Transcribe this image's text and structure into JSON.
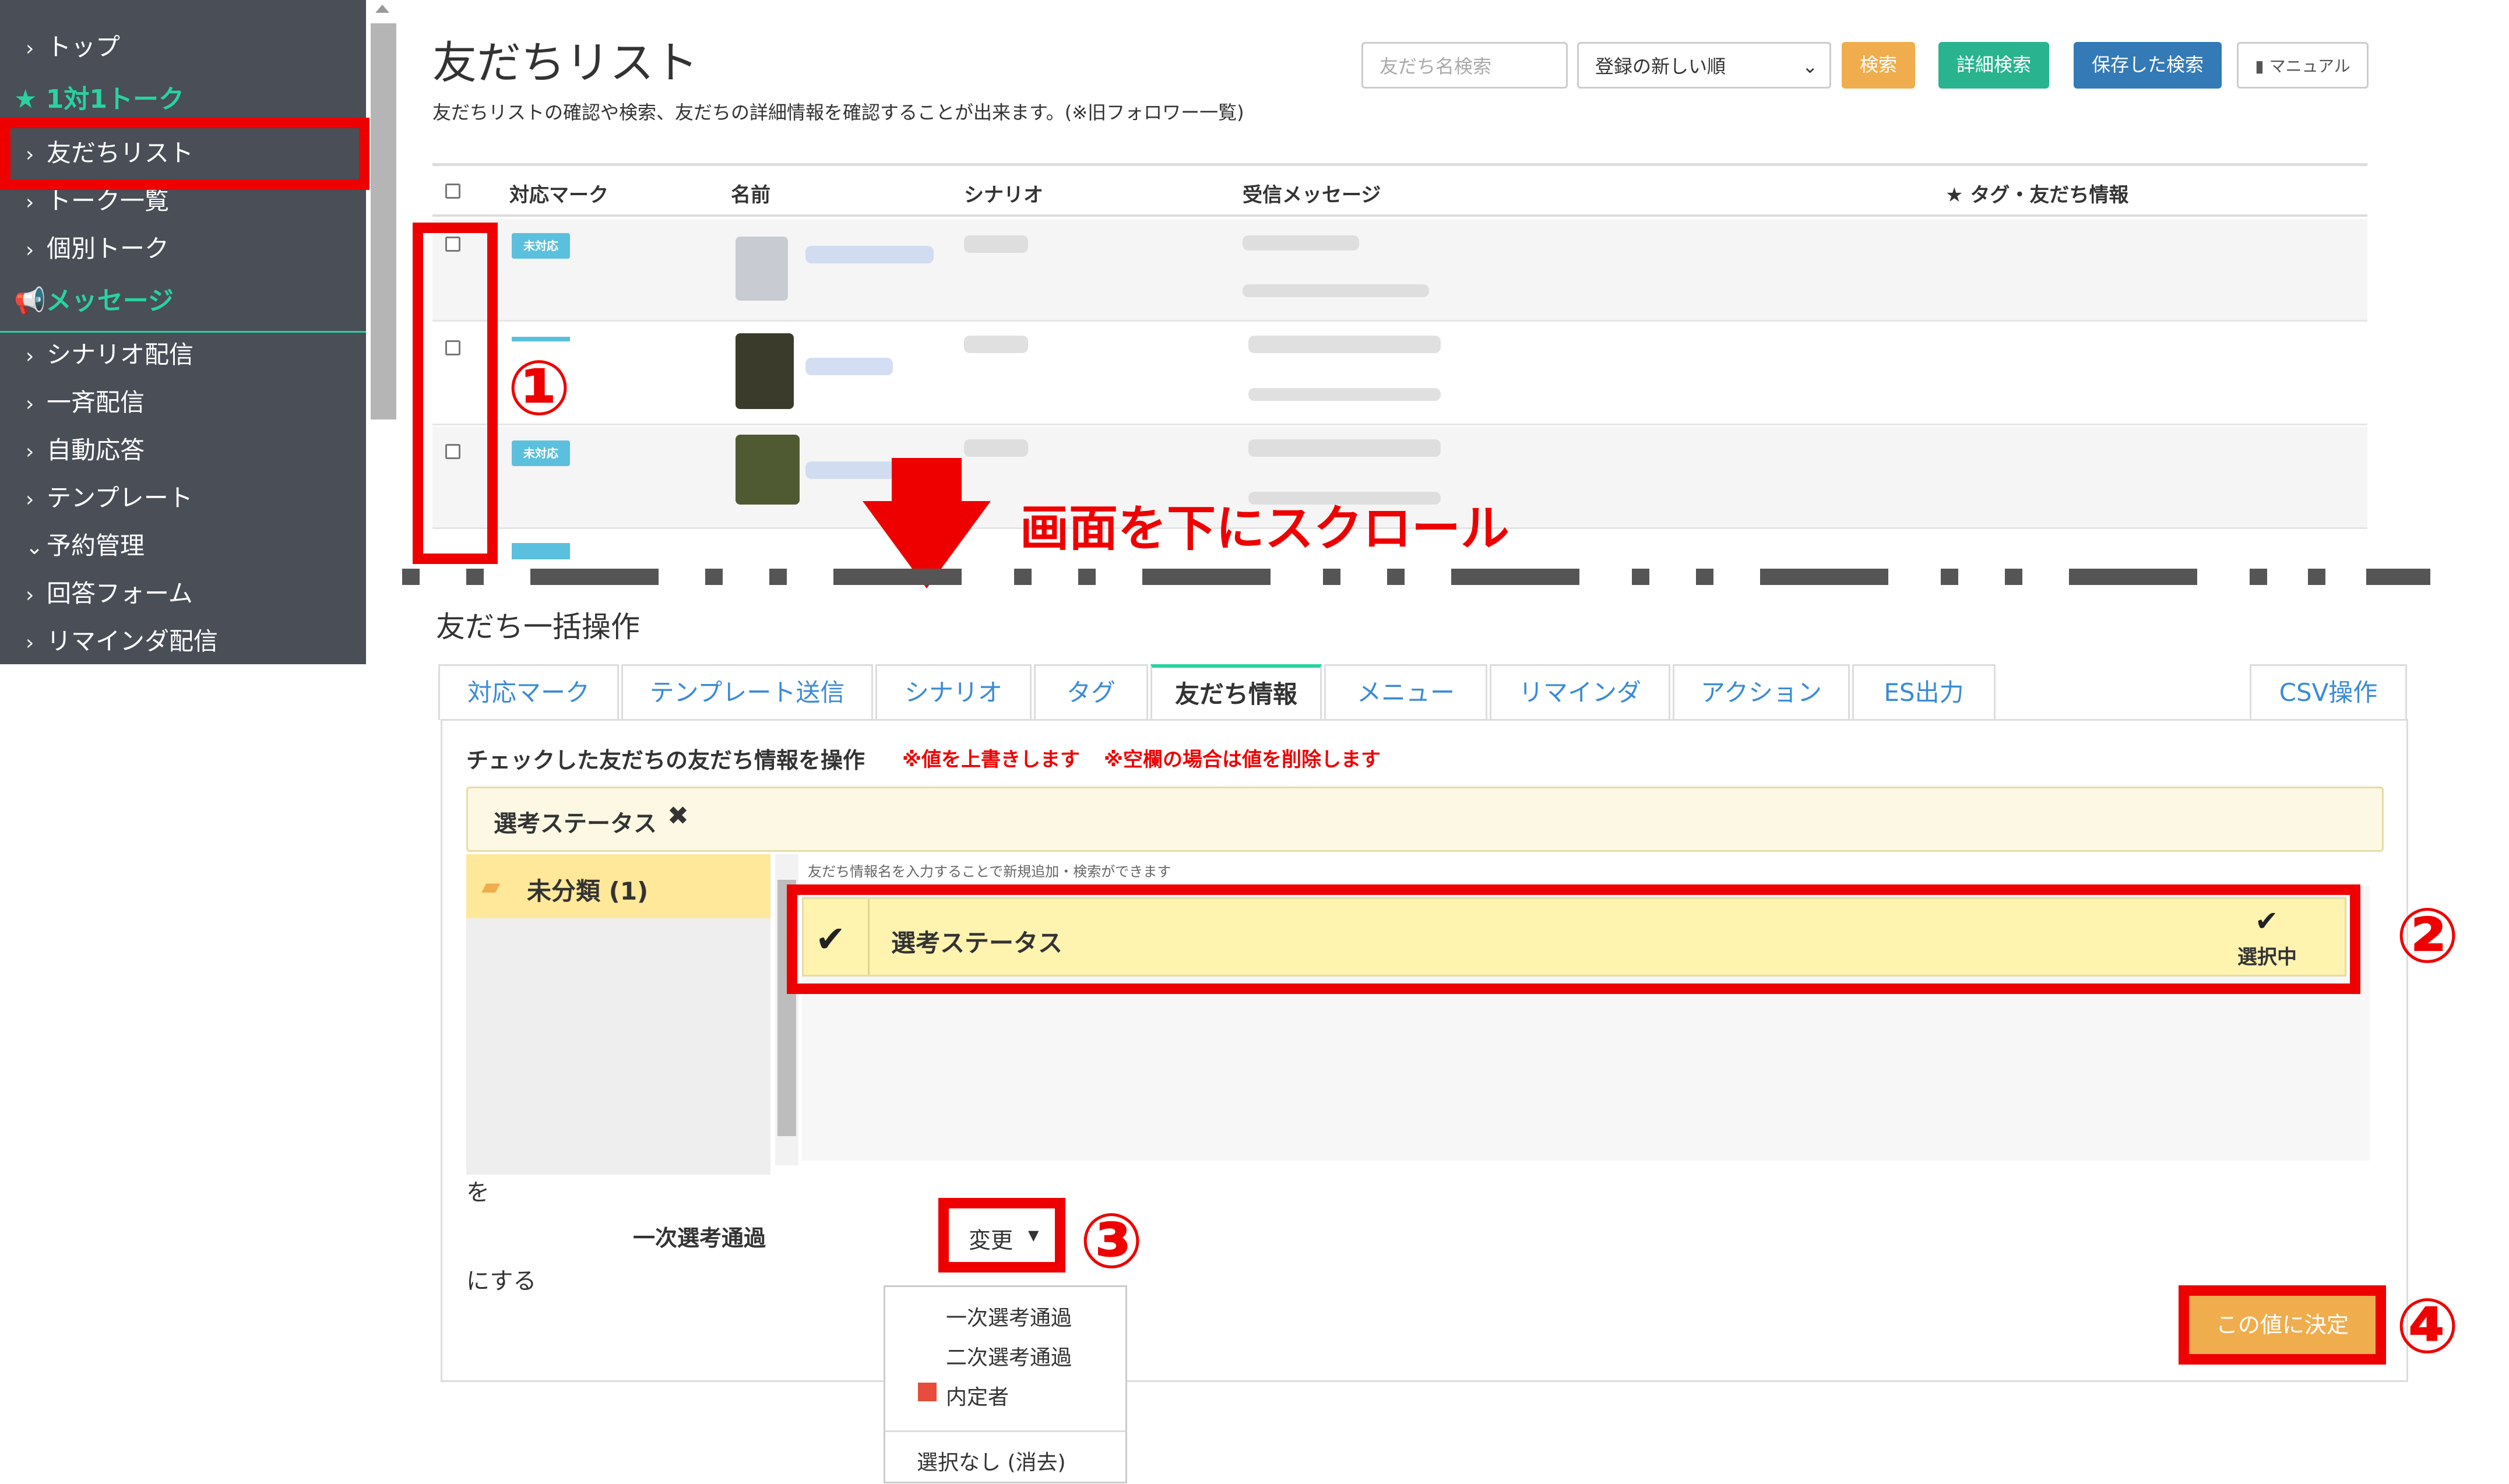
{
  "sidebar": {
    "items": [
      {
        "label": "トップ",
        "type": "item"
      },
      {
        "label": "1対1トーク",
        "type": "section",
        "icon": "star-icon"
      },
      {
        "label": "友だちリスト",
        "type": "item"
      },
      {
        "label": "トーク一覧",
        "type": "item"
      },
      {
        "label": "個別トーク",
        "type": "item"
      },
      {
        "label": "メッセージ",
        "type": "section",
        "icon": "megaphone-icon"
      },
      {
        "label": "シナリオ配信",
        "type": "item"
      },
      {
        "label": "一斉配信",
        "type": "item"
      },
      {
        "label": "自動応答",
        "type": "item"
      },
      {
        "label": "テンプレート",
        "type": "item"
      },
      {
        "label": "予約管理",
        "type": "item-expanded"
      },
      {
        "label": "回答フォーム",
        "type": "item"
      },
      {
        "label": "リマインダ配信",
        "type": "item"
      }
    ]
  },
  "header": {
    "title": "友だちリスト",
    "subtitle": "友だちリストの確認や検索、友だちの詳細情報を確認することが出来ます。(※旧フォロワー一覧)",
    "search_placeholder": "友だち名検索",
    "sort_value": "登録の新しい順",
    "search_button": "検索",
    "advanced_search_button": "詳細検索",
    "saved_search_button": "保存した検索",
    "manual_button": "マニュアル"
  },
  "table": {
    "columns": [
      "対応マーク",
      "名前",
      "シナリオ",
      "受信メッセージ",
      "★ タグ・友だち情報"
    ],
    "badge": "未対応"
  },
  "annotation": {
    "scroll_text": "画面を下にスクロール",
    "step1": "①",
    "step2": "②",
    "step3": "③",
    "step4": "④"
  },
  "bulk": {
    "heading": "友だち一括操作",
    "tabs": [
      "対応マーク",
      "テンプレート送信",
      "シナリオ",
      "タグ",
      "友だち情報",
      "メニュー",
      "リマインダ",
      "アクション",
      "ES出力"
    ],
    "csv_tab": "CSV操作",
    "instruction": "チェックした友だちの友だち情報を操作",
    "note1": "※値を上書きします",
    "note2": "※空欄の場合は値を削除します",
    "selected_tag": "選考ステータス",
    "folder": "未分類 (1)",
    "info_hint": "友だち情報名を入力することで新規追加・検索ができます",
    "item_name": "選考ステータス",
    "selected_label": "選択中",
    "wo": "を",
    "value": "一次選考通過",
    "change_button": "変更",
    "nisuru": "にする",
    "confirm_button": "この値に決定",
    "options": [
      "一次選考通過",
      "二次選考通過",
      "内定者"
    ],
    "clear_option": "選択なし (消去)"
  },
  "colors": {
    "sidebar_bg": "#494e57",
    "accent_green": "#2ad29f",
    "search_orange": "#f0ad4e",
    "teal": "#2ab38f",
    "blue": "#337ab7",
    "highlight_red": "#ee0000",
    "selected_yellow": "#fff3b0"
  }
}
